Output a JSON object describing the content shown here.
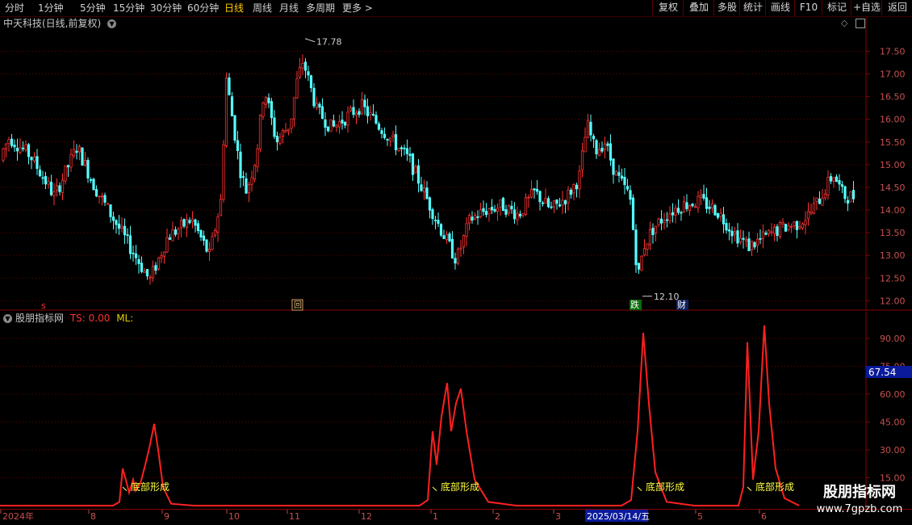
{
  "toolbar": {
    "timeframes": [
      {
        "label": "分时",
        "active": false
      },
      {
        "label": "1分钟",
        "active": false
      },
      {
        "label": "5分钟",
        "active": false
      },
      {
        "label": "15分钟",
        "active": false
      },
      {
        "label": "30分钟",
        "active": false
      },
      {
        "label": "60分钟",
        "active": false
      },
      {
        "label": "日线",
        "active": true
      },
      {
        "label": "周线",
        "active": false
      },
      {
        "label": "月线",
        "active": false
      },
      {
        "label": "多周期",
        "active": false
      },
      {
        "label": "更多 >",
        "active": false
      }
    ],
    "right_buttons": [
      "复权",
      "叠加",
      "多股",
      "统计",
      "画线",
      "F10",
      "标记",
      "+自选",
      "返回"
    ]
  },
  "chart": {
    "title": "中天科技(日线,前复权)",
    "price_axis": [
      "17.50",
      "17.00",
      "16.50",
      "16.00",
      "15.50",
      "15.00",
      "14.50",
      "14.00",
      "13.50",
      "13.00",
      "12.50",
      "12.00"
    ],
    "high_label": "17.78",
    "low_label": "12.10",
    "markers": {
      "s": "s",
      "hui": "回",
      "die": "跌",
      "cai": "财"
    }
  },
  "indicator": {
    "name": "股朋指标网",
    "ts": "TS: 0.00",
    "ml": "ML:",
    "axis": [
      "90.00",
      "75.00",
      "60.00",
      "45.00",
      "30.00",
      "15.00"
    ],
    "current": "67.54",
    "signal_label": "底部形成"
  },
  "date_axis": {
    "labels": [
      "2024年",
      "8",
      "9",
      "10",
      "11",
      "12",
      "1",
      "2",
      "3",
      "5",
      "6"
    ],
    "current": "2025/03/14/五"
  },
  "watermark": {
    "title": "股朋指标网",
    "url": "www.7gpzb.com"
  },
  "colors": {
    "up": "#ff3232",
    "down": "#54ffff",
    "line": "#ff2020",
    "grid": "#6a0000"
  },
  "chart_data": {
    "type": "candlestick",
    "ylim": [
      11.9,
      17.9
    ],
    "indicator_ylim": [
      0,
      100
    ],
    "highlights": {
      "high": 17.78,
      "low": 12.1
    },
    "indicator_series_points": [
      [
        0,
        0
      ],
      [
        140,
        0
      ],
      [
        148,
        2
      ],
      [
        152,
        20
      ],
      [
        157,
        12
      ],
      [
        160,
        7
      ],
      [
        165,
        14
      ],
      [
        168,
        8
      ],
      [
        174,
        12
      ],
      [
        180,
        22
      ],
      [
        186,
        33
      ],
      [
        191,
        44
      ],
      [
        196,
        30
      ],
      [
        202,
        10
      ],
      [
        212,
        1
      ],
      [
        240,
        0
      ],
      [
        520,
        0
      ],
      [
        530,
        3
      ],
      [
        536,
        40
      ],
      [
        541,
        22
      ],
      [
        547,
        48
      ],
      [
        554,
        66
      ],
      [
        559,
        40
      ],
      [
        565,
        55
      ],
      [
        571,
        63
      ],
      [
        578,
        40
      ],
      [
        588,
        14
      ],
      [
        605,
        2
      ],
      [
        640,
        0
      ],
      [
        770,
        0
      ],
      [
        782,
        3
      ],
      [
        790,
        40
      ],
      [
        797,
        93
      ],
      [
        804,
        55
      ],
      [
        812,
        18
      ],
      [
        826,
        2
      ],
      [
        860,
        0
      ],
      [
        915,
        0
      ],
      [
        921,
        10
      ],
      [
        926,
        88
      ],
      [
        933,
        14
      ],
      [
        940,
        40
      ],
      [
        947,
        97
      ],
      [
        953,
        55
      ],
      [
        961,
        20
      ],
      [
        972,
        4
      ],
      [
        990,
        0
      ]
    ],
    "signals_x": [
      152,
      536,
      790,
      926
    ]
  }
}
